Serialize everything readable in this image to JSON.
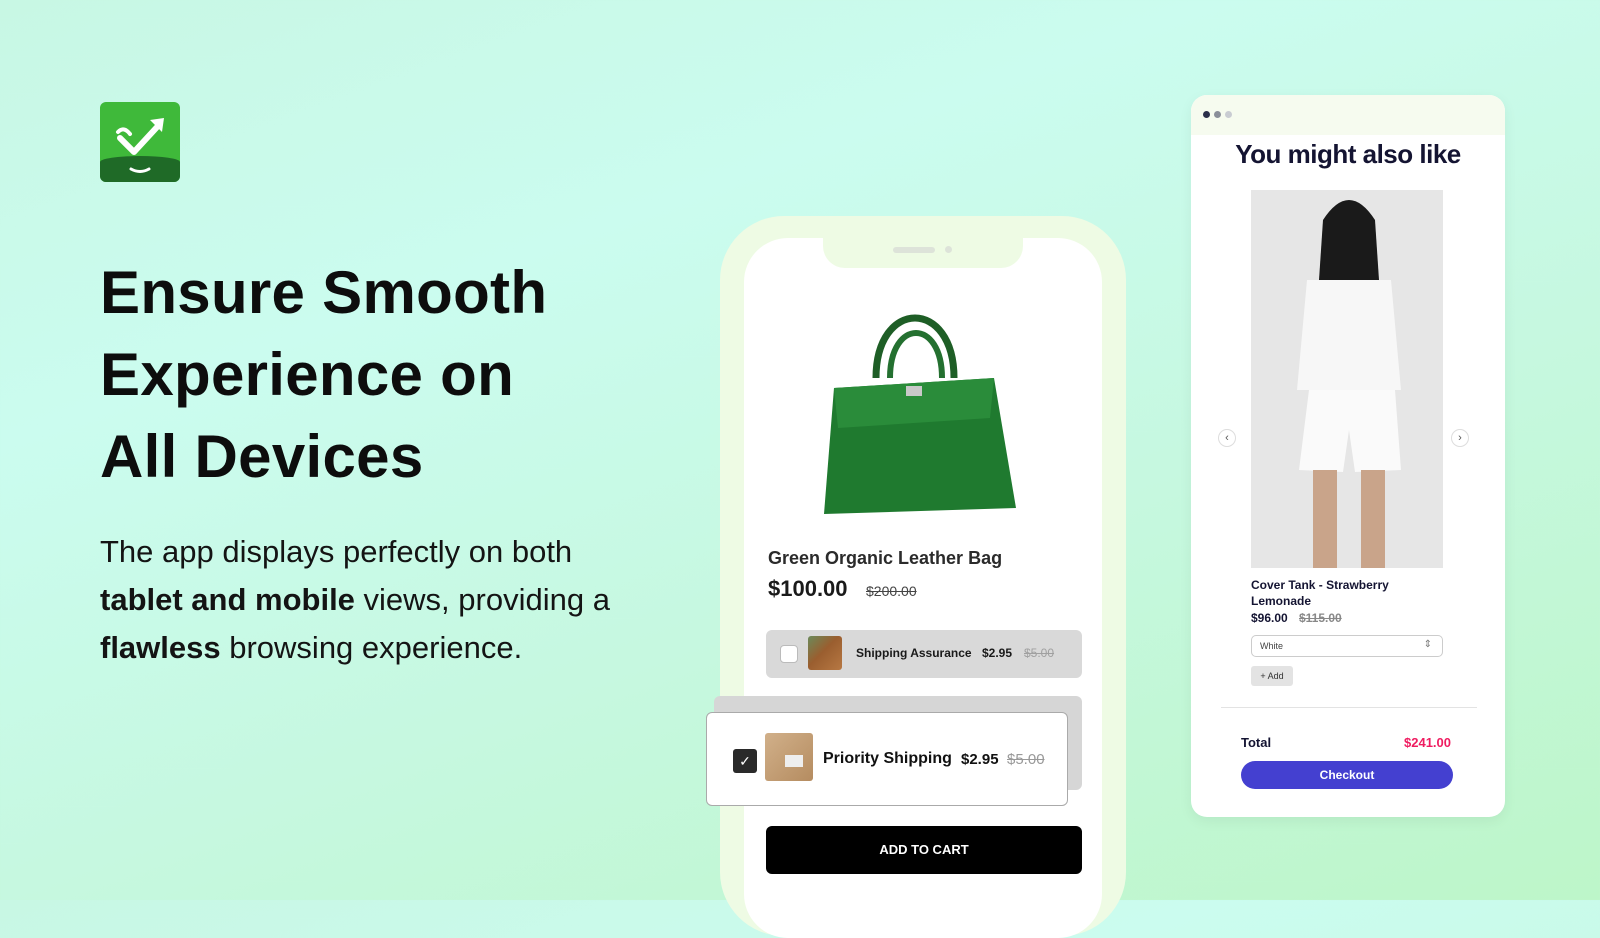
{
  "logo": {
    "icon": "check-trend-arrow-icon",
    "brand_color": "#3fb93a",
    "dark_color": "#1f6a27"
  },
  "headline": {
    "line1": "Ensure Smooth",
    "line2": "Experience on",
    "line3": "All Devices"
  },
  "description": {
    "part1": "The app displays perfectly on both ",
    "bold1": "tablet and mobile",
    "part2": " views, providing a ",
    "bold2": "flawless",
    "part3": " browsing experience."
  },
  "phone": {
    "product": {
      "image": "green-leather-bag",
      "title": "Green Organic Leather Bag",
      "price": "$100.00",
      "compare_price": "$200.00"
    },
    "shipping_assurance": {
      "label": "Shipping Assurance",
      "price": "$2.95",
      "compare_price": "$5.00",
      "checked": false
    },
    "priority_shipping": {
      "label": "Priority Shipping",
      "price": "$2.95",
      "compare_price": "$5.00",
      "checked": true,
      "check_glyph": "✓"
    },
    "add_to_cart_label": "ADD TO CART"
  },
  "tablet": {
    "title": "You might also like",
    "prev_glyph": "‹",
    "next_glyph": "›",
    "product": {
      "title": "Cover Tank - Strawberry Lemonade",
      "price": "$96.00",
      "compare_price": "$115.00",
      "variant": "White",
      "add_label": "+ Add"
    },
    "total_label": "Total",
    "total_value": "$241.00",
    "checkout_label": "Checkout",
    "accent": "#4440d0",
    "total_color": "#ef1c60"
  }
}
